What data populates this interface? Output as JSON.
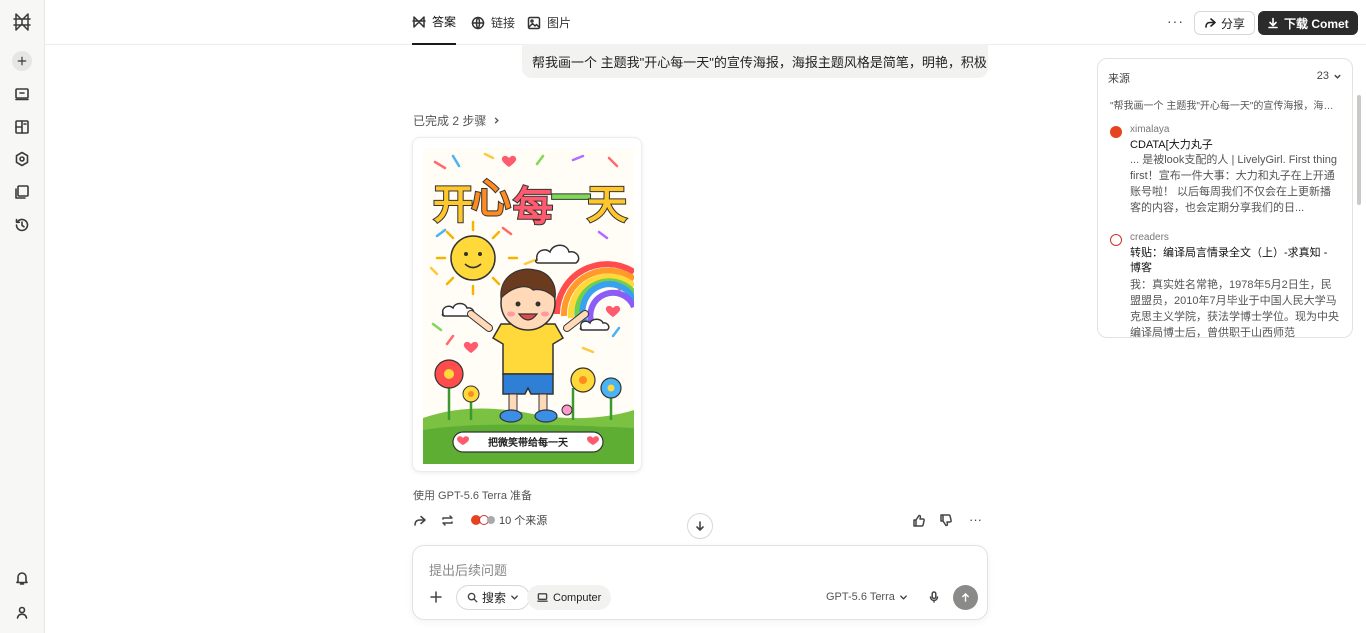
{
  "tabs": [
    {
      "label": "答案",
      "icon": "answer-icon",
      "active": true
    },
    {
      "label": "链接",
      "icon": "globe-icon",
      "active": false
    },
    {
      "label": "图片",
      "icon": "image-icon",
      "active": false
    }
  ],
  "header": {
    "more_label": "···",
    "share_label": "分享",
    "download_label": "下载 Comet"
  },
  "query": {
    "text": "帮我画一个 主题我\"开心每一天\"的宣传海报，海报主题风格是简笔，明艳，积极"
  },
  "steps": {
    "label": "已完成 2 步骤"
  },
  "poster": {
    "title": "开心每一天",
    "banner": "把微笑带给每一天",
    "colors": {
      "background": "#fffdf6",
      "grass": "#7cc242",
      "shirt": "#ffd83a",
      "shorts": "#2f7fd6"
    }
  },
  "model_note": "使用 GPT-5.6 Terra 准备",
  "actions": {
    "sources_label": "10 个来源"
  },
  "composer": {
    "placeholder": "提出后续问题",
    "search_label": "搜索",
    "computer_label": "Computer",
    "model_label": "GPT-5.6 Terra"
  },
  "sources_panel": {
    "title": "来源",
    "count": "23",
    "query_line": "\"帮我画一个 主题我\"开心每一天\"的宣传海报，海报...",
    "items": [
      {
        "site": "ximalaya",
        "title": "CDATA[大力丸子",
        "snippet": "... 是被look支配的人 | LivelyGirl. First thing first！宣布一件大事：大力和丸子在上开通账号啦！ 以后每周我们不仅会在上更新播客的内容，也会定期分享我们的日...",
        "favicon_color": "#e8431f"
      },
      {
        "site": "creaders",
        "title": "转贴：编译局言情录全文（上）-求真知 - 博客",
        "snippet": "我：真实姓名常艳，1978年5月2日生，民盟盟员，2010年7月毕业于中国人民大学马克思主义学院，获法学博士学位。现为中央编译局博士后，曾供职于山西师范",
        "favicon_color": "#ffffff"
      }
    ]
  }
}
